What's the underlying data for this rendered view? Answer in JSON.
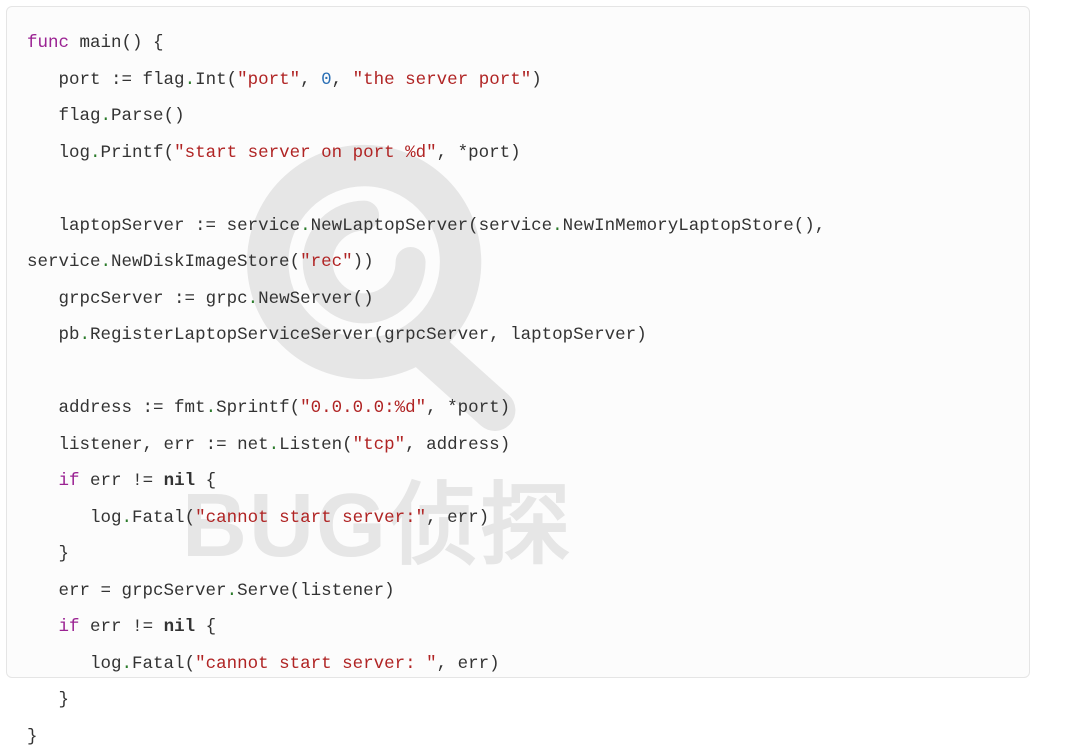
{
  "watermark": {
    "text": "BUG侦探"
  },
  "code": {
    "s_port": "\"port\"",
    "s_desc": "\"the server port\"",
    "s_start": "\"start server on port %d\"",
    "s_rec": "\"rec\"",
    "s_addr": "\"0.0.0.0:%d\"",
    "s_tcp": "\"tcp\"",
    "s_err1": "\"cannot start server:\"",
    "s_err2": "\"cannot start server: \"",
    "n_zero": "0",
    "kw_func": "func",
    "kw_if1": "if",
    "kw_if2": "if",
    "kw_nil1": "nil",
    "kw_nil2": "nil",
    "id_main": "main",
    "id_port": "port",
    "id_port2": "port",
    "id_port3": "port",
    "id_flag": "flag",
    "id_flag2": "flag",
    "id_Int": "Int",
    "id_Parse": "Parse",
    "id_log": "log",
    "id_log2": "log",
    "id_log3": "log",
    "id_Printf": "Printf",
    "id_laptopServer": "laptopServer",
    "id_laptopServer2": "laptopServer",
    "id_service": "service",
    "id_service2": "service",
    "id_service3": "service",
    "id_NewLaptopServer": "NewLaptopServer",
    "id_NewInMemoryLaptopStore": "NewInMemoryLaptopStore",
    "id_NewDiskImageStore": "NewDiskImageStore",
    "id_grpcServer": "grpcServer",
    "id_grpcServer2": "grpcServer",
    "id_grpcServer3": "grpcServer",
    "id_grpc": "grpc",
    "id_NewServer": "NewServer",
    "id_pb": "pb",
    "id_RegisterLaptopServiceServer": "RegisterLaptopServiceServer",
    "id_address": "address",
    "id_address2": "address",
    "id_fmt": "fmt",
    "id_Sprintf": "Sprintf",
    "id_listener": "listener",
    "id_listener2": "listener",
    "id_err": "err",
    "id_err2": "err",
    "id_err3": "err",
    "id_err4": "err",
    "id_err5": "err",
    "id_err6": "err",
    "id_net": "net",
    "id_Listen": "Listen",
    "id_Fatal": "Fatal",
    "id_Fatal2": "Fatal",
    "id_Serve": "Serve"
  }
}
